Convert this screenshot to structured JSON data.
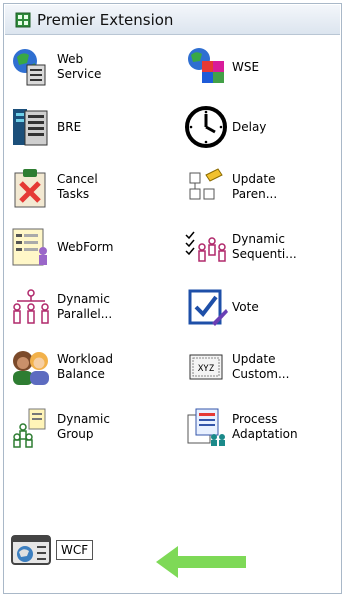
{
  "panel": {
    "title": "Premier Extension"
  },
  "items": [
    {
      "label": "Web\nService",
      "icon": "web-service-icon"
    },
    {
      "label": "WSE",
      "icon": "wse-icon"
    },
    {
      "label": "BRE",
      "icon": "bre-icon"
    },
    {
      "label": "Delay",
      "icon": "clock-icon"
    },
    {
      "label": "Cancel\nTasks",
      "icon": "cancel-tasks-icon"
    },
    {
      "label": "Update\nParen...",
      "icon": "update-parent-icon"
    },
    {
      "label": "WebForm",
      "icon": "webform-icon"
    },
    {
      "label": "Dynamic\nSequenti...",
      "icon": "dynamic-sequential-icon"
    },
    {
      "label": "Dynamic\nParallel...",
      "icon": "dynamic-parallel-icon"
    },
    {
      "label": "Vote",
      "icon": "vote-icon"
    },
    {
      "label": "Workload\nBalance",
      "icon": "workload-balance-icon"
    },
    {
      "label": "Update\nCustom...",
      "icon": "update-custom-icon"
    },
    {
      "label": "Dynamic\nGroup",
      "icon": "dynamic-group-icon"
    },
    {
      "label": "Process\nAdaptation",
      "icon": "process-adaptation-icon"
    },
    {
      "label": "WCF",
      "icon": "wcf-icon"
    }
  ],
  "badges": {
    "xyz": "XYZ"
  },
  "colors": {
    "header_bg": "#dce5ef",
    "arrow": "#7ed957"
  }
}
